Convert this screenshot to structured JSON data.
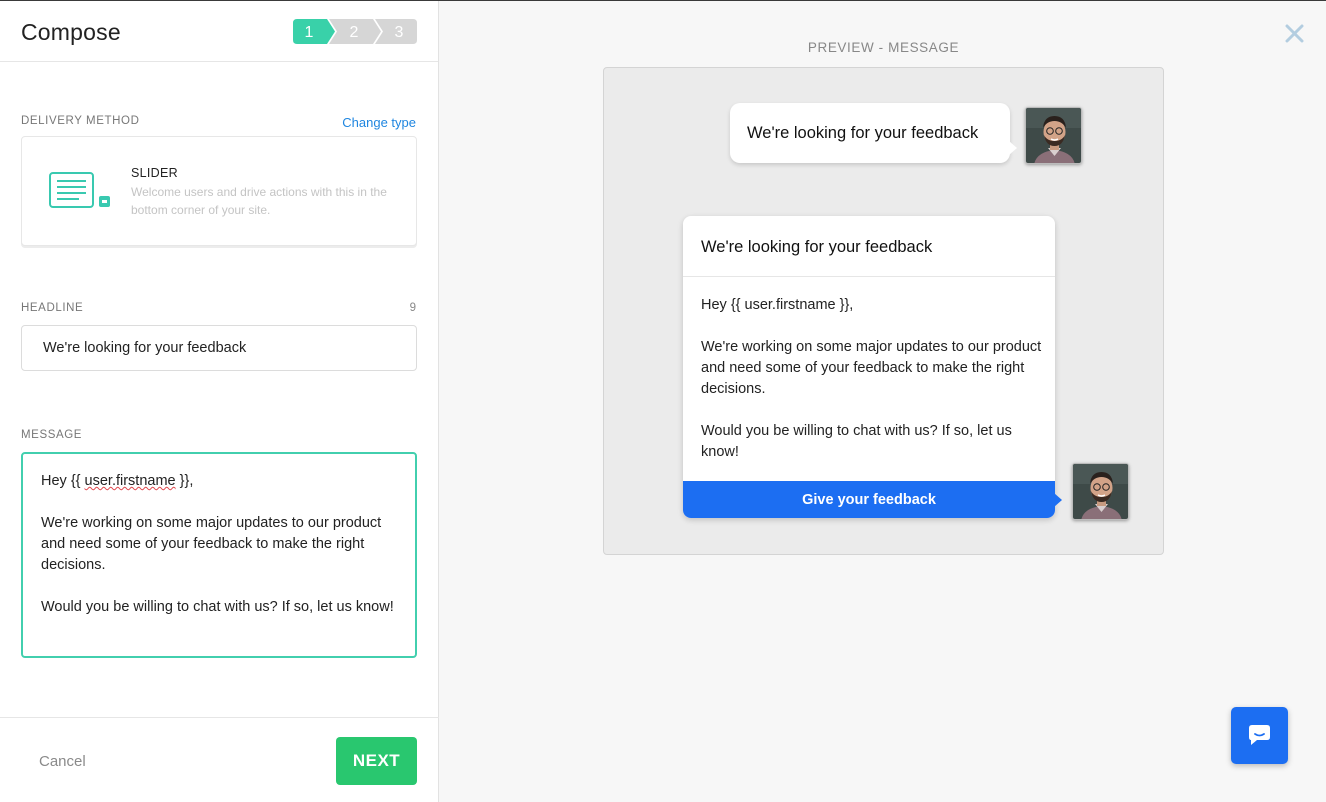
{
  "compose": {
    "title": "Compose",
    "steps": [
      "1",
      "2",
      "3"
    ],
    "active_step": 1,
    "colors": {
      "active_step": "#39d1a9",
      "inactive_step": "#d6d6d6"
    }
  },
  "delivery": {
    "label": "DELIVERY METHOD",
    "change_type": "Change type",
    "method_name": "SLIDER",
    "method_description": "Welcome users and drive actions with this in the bottom corner of your site.",
    "icon": "slider-window-icon"
  },
  "headline": {
    "label": "HEADLINE",
    "char_count": "9",
    "value": "We're looking for your feedback"
  },
  "message": {
    "label": "MESSAGE",
    "greeting_prefix": "Hey {{ ",
    "greeting_var": "user.firstname",
    "greeting_suffix": " }},",
    "body": "\n\nWe're working on some major updates to our product and need some of your feedback to make the right decisions.\n\nWould you be willing to chat with us? If so, let us know!"
  },
  "footer": {
    "cancel": "Cancel",
    "next": "NEXT",
    "colors": {
      "next": "#29c76f"
    }
  },
  "preview": {
    "title": "PREVIEW - MESSAGE",
    "bubble_text": "We're looking for your feedback",
    "card_title": "We're looking for your feedback",
    "card_body": "Hey {{ user.firstname }},\n\nWe're working on some major updates to our product and need some of your feedback to make the right decisions.\n\nWould you be willing to chat with us? If so, let us know!",
    "cta": "Give your feedback",
    "colors": {
      "cta": "#1c6ef2"
    }
  },
  "icons": {
    "close": "close-icon",
    "chat": "chat-bubble-icon"
  }
}
